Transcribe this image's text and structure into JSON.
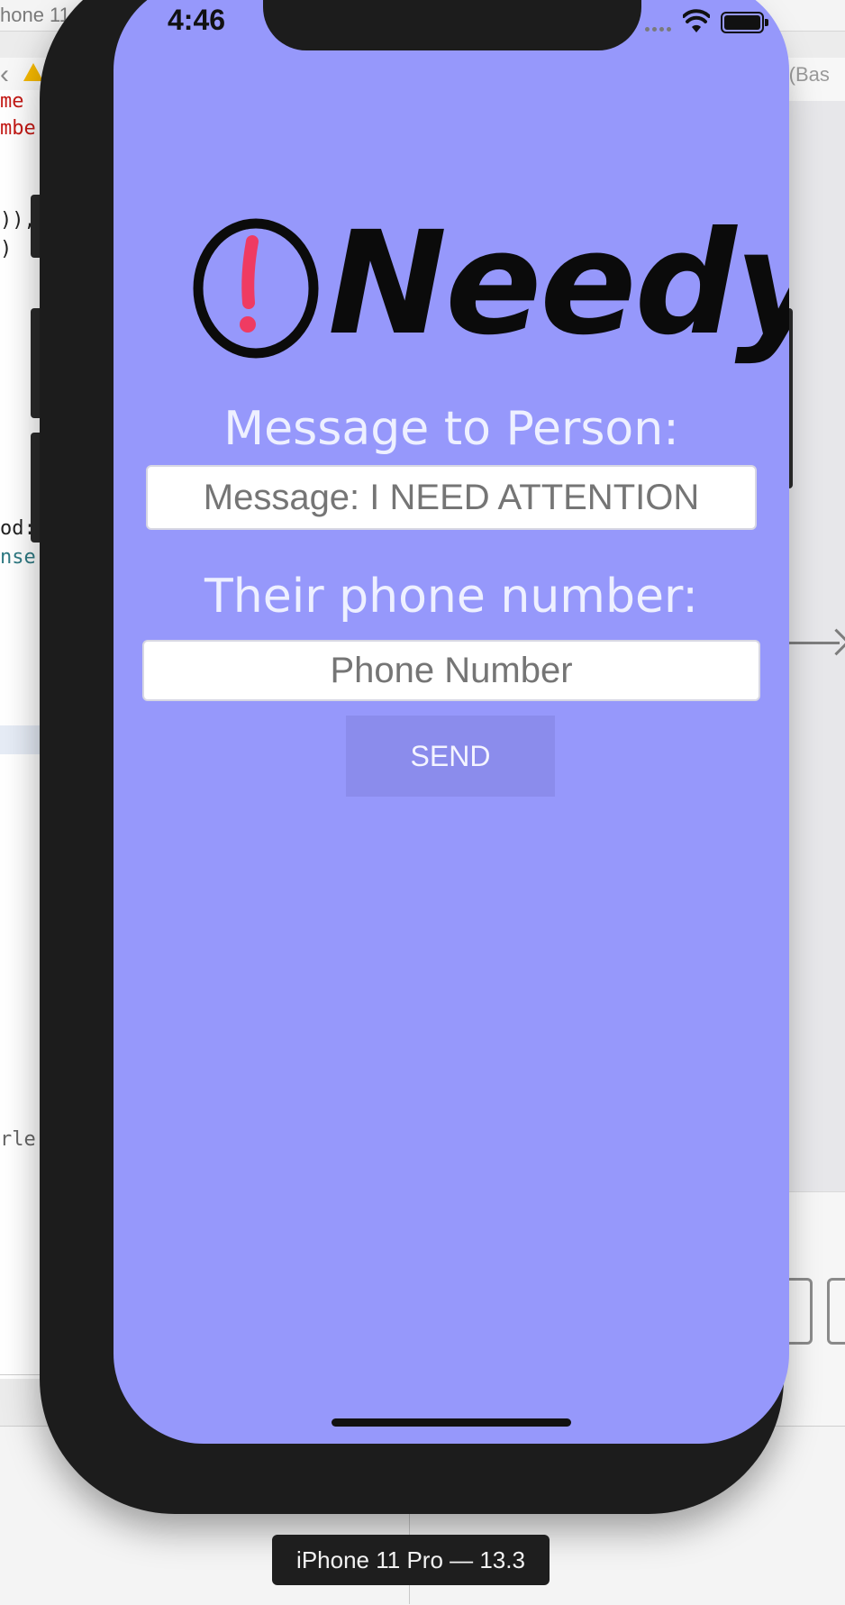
{
  "xcode": {
    "tab_title": "hone 11",
    "breadcrumb_right": "rd (Bas",
    "code_fragments": [
      "me",
      "mbe",
      ")),",
      ")",
      "od:",
      "nse",
      "rle"
    ]
  },
  "simulator": {
    "device_label": "iPhone 11 Pro — 13.3"
  },
  "status_bar": {
    "time": "4:46"
  },
  "app": {
    "logo_text": "Needy",
    "message_label": "Message to Person:",
    "message_placeholder": "Message: I NEED ATTENTION",
    "phone_label": "Their phone number:",
    "phone_placeholder": "Phone Number",
    "send_label": "SEND"
  },
  "colors": {
    "background": "#9698fb",
    "logo_accent": "#ef3b62",
    "send_button": "#8b8cec"
  }
}
